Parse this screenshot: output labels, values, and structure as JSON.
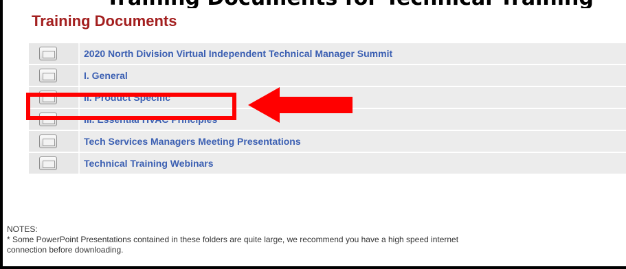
{
  "page": {
    "top_caption": "Training Documents for Technical Training",
    "title": "Training Documents"
  },
  "folders": [
    {
      "label": "2020 North Division Virtual Independent Technical Manager Summit",
      "icon": "folder-icon"
    },
    {
      "label": "I. General",
      "icon": "folder-icon"
    },
    {
      "label": "II. Product Specific",
      "icon": "folder-icon"
    },
    {
      "label": "III. Essential HVAC Principles",
      "icon": "folder-icon"
    },
    {
      "label": "Tech Services Managers Meeting Presentations",
      "icon": "folder-icon"
    },
    {
      "label": "Technical Training Webinars",
      "icon": "folder-icon"
    }
  ],
  "notes": {
    "heading": "NOTES:",
    "line1": "* Some PowerPoint Presentations contained in these folders are quite large, we recommend you have a high speed internet",
    "line2": "connection before downloading."
  },
  "colors": {
    "title": "#a31f1f",
    "link": "#3b5fb2",
    "annotation": "#ff0000"
  }
}
